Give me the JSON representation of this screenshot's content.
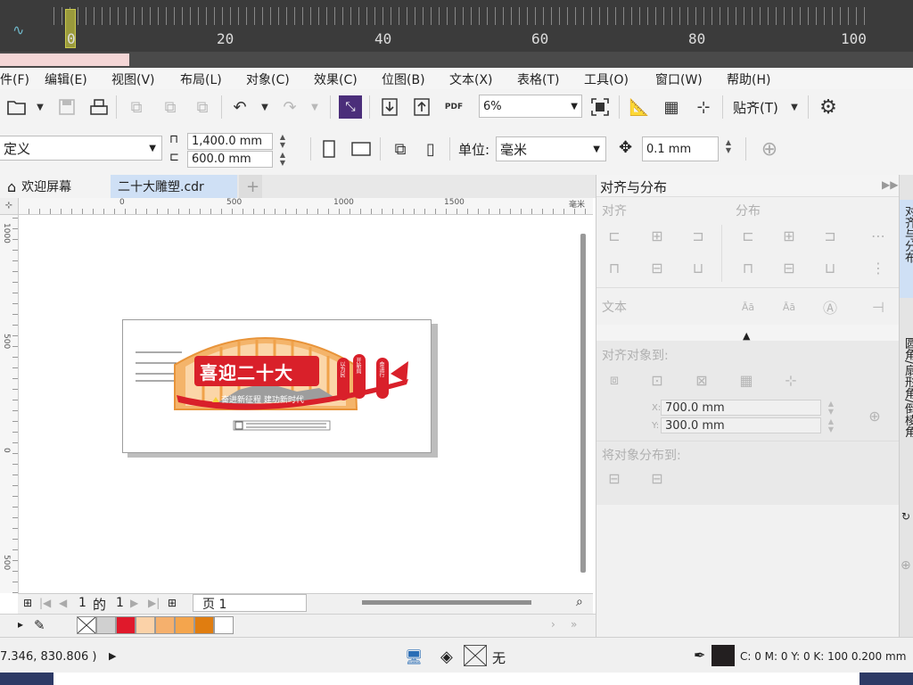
{
  "timeline": {
    "labels": [
      "0",
      "20",
      "40",
      "60",
      "80",
      "100"
    ]
  },
  "menu": [
    "件(F)",
    "编辑(E)",
    "视图(V)",
    "布局(L)",
    "对象(C)",
    "效果(C)",
    "位图(B)",
    "文本(X)",
    "表格(T)",
    "工具(O)",
    "窗口(W)",
    "帮助(H)"
  ],
  "toolbar": {
    "zoom_value": "6%",
    "snap_label": "贴齐(T)"
  },
  "propbar": {
    "preset_label": "定义",
    "width": "1,400.0 mm",
    "height": "600.0 mm",
    "unit_label": "单位:",
    "unit_value": "毫米",
    "nudge": "0.1 mm"
  },
  "tabs": {
    "welcome": "欢迎屏幕",
    "doc": "二十大雕塑.cdr"
  },
  "ruler": {
    "h_labels": [
      "0",
      "500",
      "1000",
      "1500",
      "毫米"
    ],
    "v_labels": [
      "1000",
      "500",
      "0",
      "500"
    ]
  },
  "artwork": {
    "title": "喜迎二十大",
    "subtitle": "奋进新征程 建功新时代",
    "tag1": "以为民",
    "tag2": "开新局",
    "tag3": "奋进行"
  },
  "pagenav": {
    "current": "1",
    "of": "的",
    "total": "1",
    "page_tab": "页 1"
  },
  "palette": {
    "colors": [
      "#ffffff",
      "#d0d0d0",
      "#e0192b",
      "#fbd2a8",
      "#f5b06d",
      "#f4a54d",
      "#e07d10",
      "#ffffff"
    ]
  },
  "status": {
    "coords": "7.346, 830.806 )",
    "fill_label": "无",
    "color_info": "C: 0 M: 0 Y: 0 K: 100  0.200 mm"
  },
  "docker": {
    "title": "对齐与分布",
    "align": "对齐",
    "distribute": "分布",
    "text": "文本",
    "align_to": "对齐对象到:",
    "x": "700.0 mm",
    "y": "300.0 mm",
    "x_label": "X:",
    "y_label": "Y:",
    "distribute_to": "将对象分布到:",
    "side_tabs": [
      "对齐与分布",
      "圆角/扇形角/倒棱角"
    ]
  },
  "colors": {
    "accent_red": "#d9202a",
    "orange": "#f0a24a"
  }
}
